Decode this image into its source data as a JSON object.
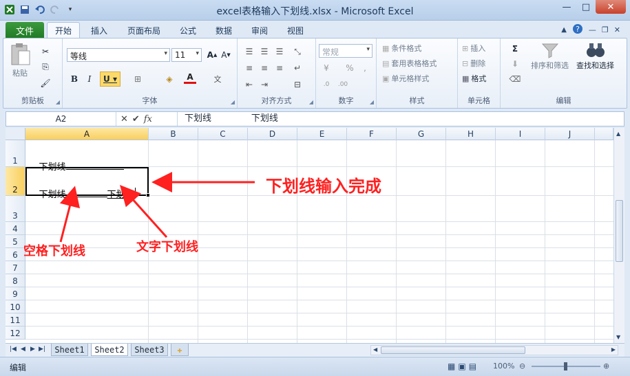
{
  "window": {
    "title": "excel表格输入下划线.xlsx - Microsoft Excel",
    "min_label": "—",
    "max_label": "□",
    "close_label": "✕"
  },
  "tabs": {
    "file": "文件",
    "items": [
      "开始",
      "插入",
      "页面布局",
      "公式",
      "数据",
      "审阅",
      "视图"
    ],
    "active": "开始"
  },
  "ribbon": {
    "clipboard": {
      "label": "剪贴板",
      "paste": "粘贴"
    },
    "font": {
      "label": "字体",
      "family": "等线",
      "size": "11"
    },
    "alignment": {
      "label": "对齐方式"
    },
    "number": {
      "label": "数字",
      "format": "常规"
    },
    "styles": {
      "label": "样式",
      "conditional": "条件格式",
      "table": "套用表格格式",
      "cell": "单元格样式"
    },
    "cells": {
      "label": "单元格",
      "insert": "插入",
      "delete": "删除",
      "format": "格式"
    },
    "editing": {
      "label": "编辑",
      "sort": "排序和筛选",
      "find": "查找和选择"
    }
  },
  "formula_bar": {
    "name_box": "A2",
    "fx": "fx",
    "content": "下划线              下划线"
  },
  "grid": {
    "columns": [
      "A",
      "B",
      "C",
      "D",
      "E",
      "F",
      "G",
      "H",
      "I",
      "J"
    ],
    "selected_column": "A",
    "rows": [
      "1",
      "2",
      "3",
      "4",
      "5",
      "6",
      "7",
      "8",
      "9",
      "10",
      "11",
      "12"
    ],
    "selected_row": "2",
    "cells": {
      "A1": "下划线",
      "A2_left": "下划线",
      "A2_right": "下划线"
    }
  },
  "sheets": {
    "tabs": [
      "Sheet1",
      "Sheet2",
      "Sheet3"
    ],
    "active": "Sheet2"
  },
  "status": {
    "mode": "编辑",
    "zoom": "100%"
  },
  "annotations": {
    "done": "下划线输入完成",
    "space_underline": "空格下划线",
    "text_underline": "文字下划线"
  },
  "colors": {
    "file_tab": "#1f7a24",
    "annotation": "#ff2020",
    "selection_header": "#f9cf5e"
  }
}
